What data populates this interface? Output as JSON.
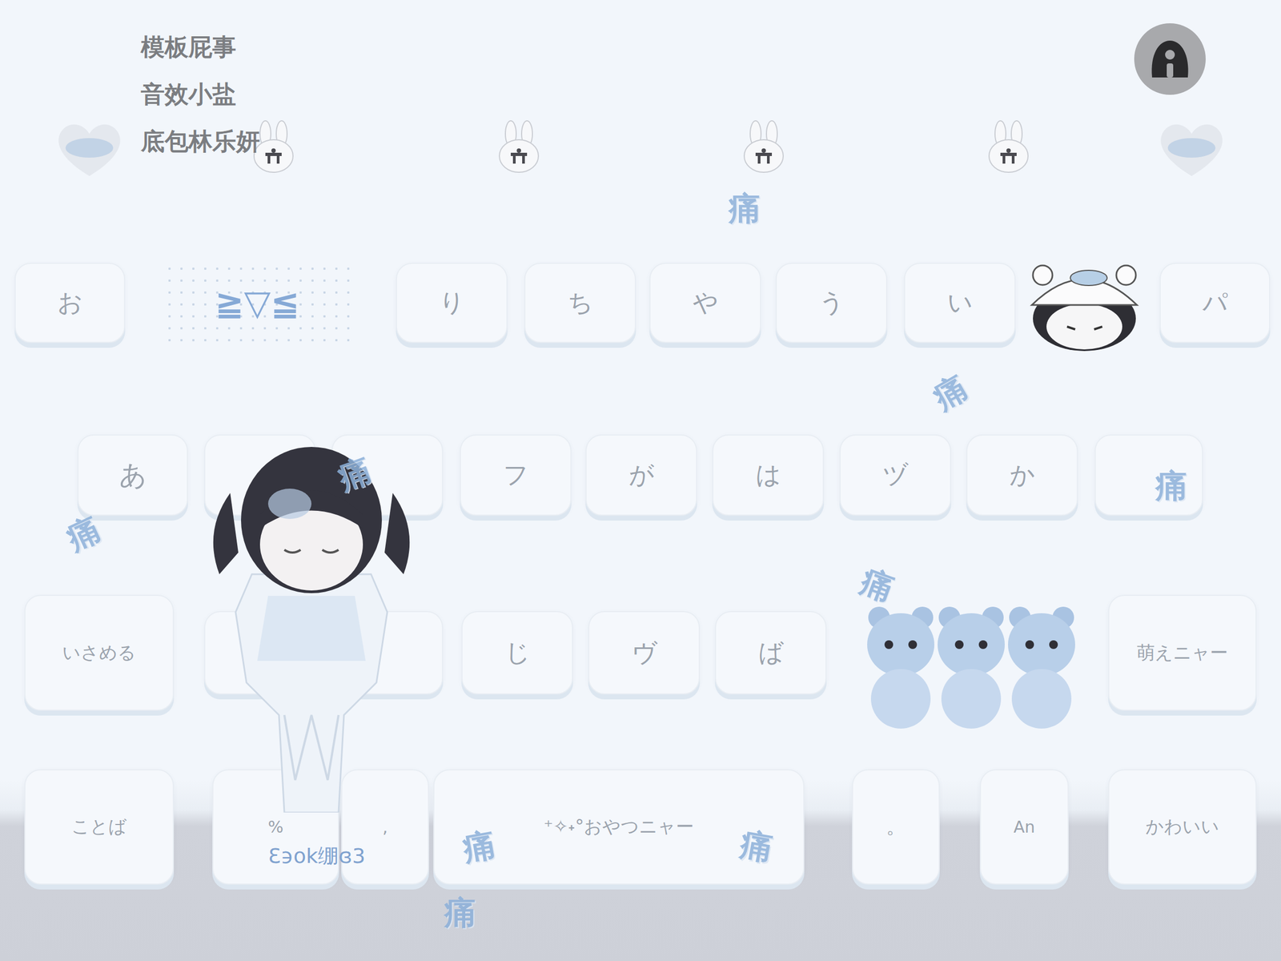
{
  "credits": [
    "模板屁事",
    "音效小盐",
    "底包林乐妍"
  ],
  "keyboard": {
    "rows": [
      {
        "keys": [
          {
            "label": "お",
            "kind": "key"
          },
          {
            "label": "≧▽≦",
            "kind": "candidate"
          },
          {
            "label": "り",
            "kind": "key"
          },
          {
            "label": "ち",
            "kind": "key"
          },
          {
            "label": "や",
            "kind": "key"
          },
          {
            "label": "う",
            "kind": "key"
          },
          {
            "label": "い",
            "kind": "key"
          },
          {
            "label": "パ",
            "kind": "key"
          }
        ]
      },
      {
        "keys": [
          {
            "label": "あ",
            "kind": "key"
          },
          {
            "label": "",
            "kind": "blank"
          },
          {
            "label": "",
            "kind": "blank"
          },
          {
            "label": "フ",
            "kind": "key"
          },
          {
            "label": "が",
            "kind": "key"
          },
          {
            "label": "は",
            "kind": "key"
          },
          {
            "label": "ヅ",
            "kind": "key"
          },
          {
            "label": "か",
            "kind": "key"
          },
          {
            "label": "",
            "kind": "blank"
          }
        ]
      },
      {
        "keys": [
          {
            "label": "いさめる",
            "kind": "key"
          },
          {
            "label": "",
            "kind": "blank"
          },
          {
            "label": "",
            "kind": "blank"
          },
          {
            "label": "じ",
            "kind": "key"
          },
          {
            "label": "ヴ",
            "kind": "key"
          },
          {
            "label": "ば",
            "kind": "key"
          },
          {
            "label": "萌えニャー",
            "kind": "key"
          }
        ]
      },
      {
        "keys": [
          {
            "label": "ことば",
            "kind": "key"
          },
          {
            "label": "%",
            "kind": "key"
          },
          {
            "label": ",",
            "kind": "key"
          },
          {
            "label": "⁺✧˖°おやつニャー",
            "kind": "key"
          },
          {
            "label": "。",
            "kind": "key"
          },
          {
            "label": "An",
            "kind": "key"
          },
          {
            "label": "かわいい",
            "kind": "key"
          }
        ]
      }
    ]
  },
  "sticker_text": "Ɛ϶ok绷ɞ3",
  "stamps": [
    {
      "text": "痛"
    },
    {
      "text": "痛"
    },
    {
      "text": "痛"
    },
    {
      "text": "痛"
    },
    {
      "text": "痛"
    },
    {
      "text": "痛"
    },
    {
      "text": "痛"
    },
    {
      "text": "痛"
    },
    {
      "text": "痛"
    }
  ]
}
